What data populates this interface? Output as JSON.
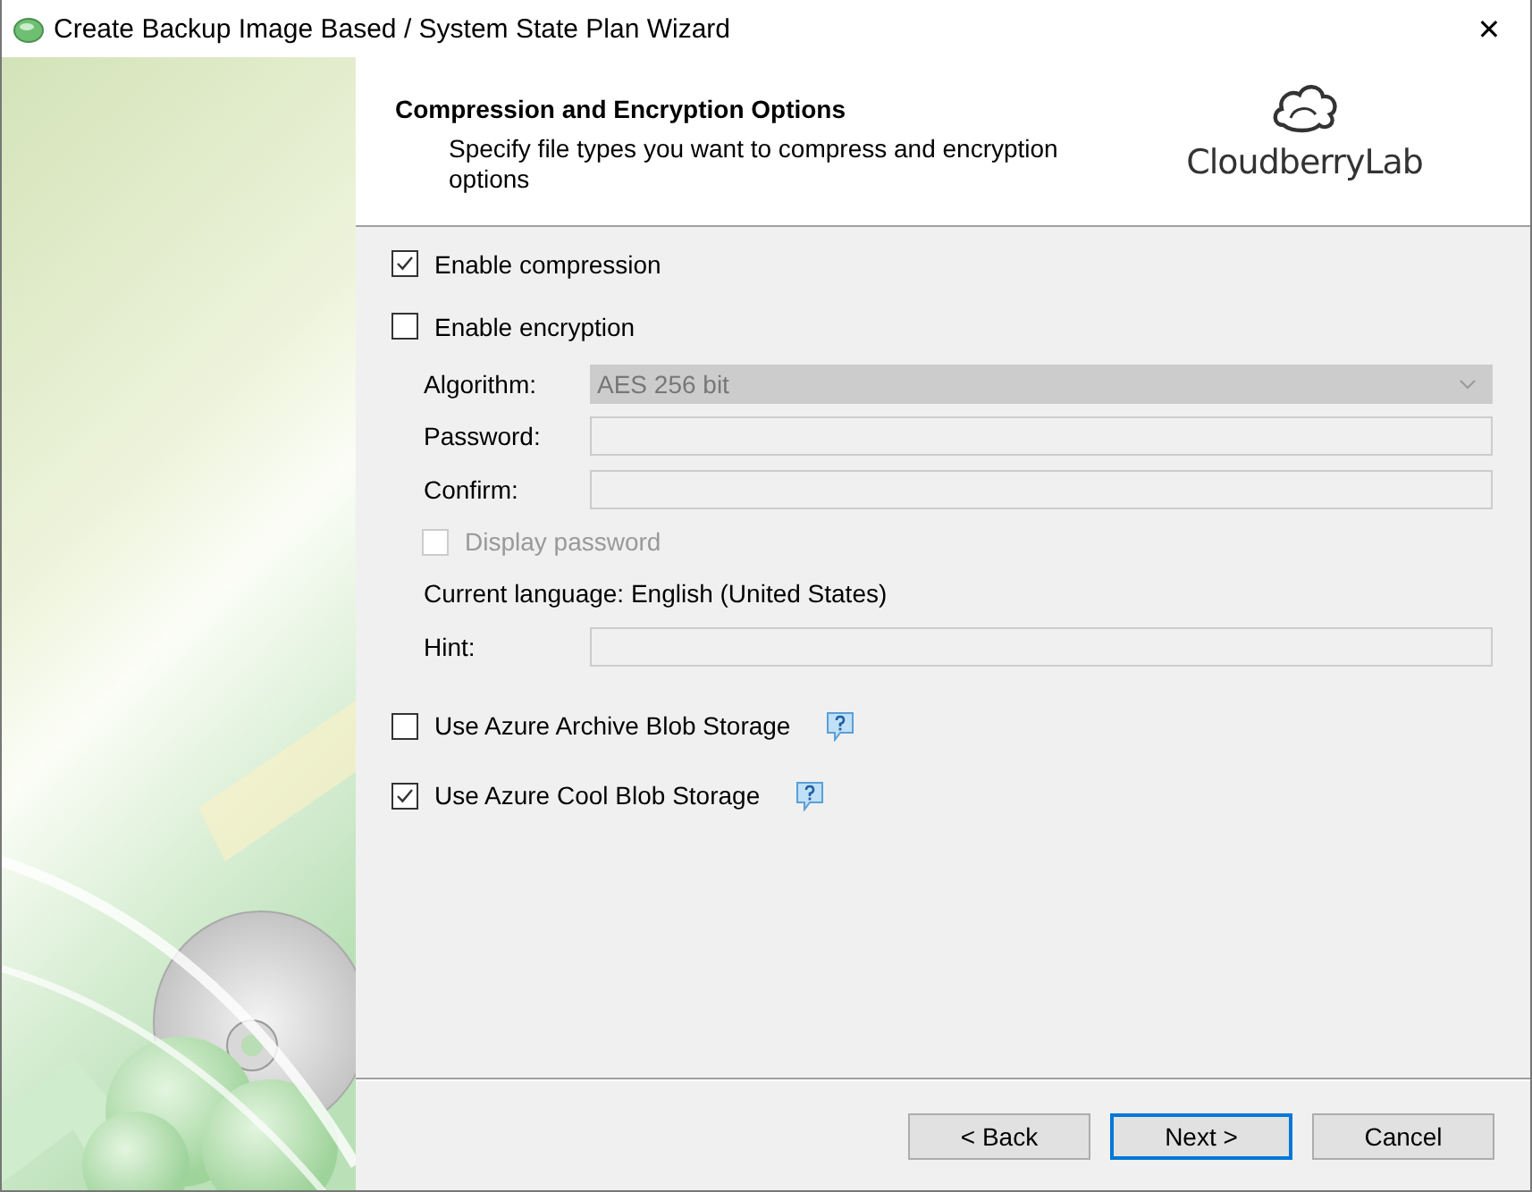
{
  "window": {
    "title": "Create Backup Image Based / System State Plan Wizard",
    "close": "✕"
  },
  "header": {
    "title": "Compression and Encryption Options",
    "subtitle": "Specify file types you want to compress and encryption options",
    "logo_text": "CloudberryLab"
  },
  "items": [
    {
      "kind": "checkbox",
      "label": "Enable compression",
      "checked": true,
      "disabled": false
    },
    {
      "kind": "checkbox",
      "label": "Enable encryption",
      "checked": false,
      "disabled": false
    },
    {
      "kind": "select",
      "label": "Algorithm:",
      "value": "AES 256 bit",
      "disabled": true
    },
    {
      "kind": "input",
      "label": "Password:",
      "disabled": true
    },
    {
      "kind": "input",
      "label": "Confirm:",
      "disabled": true
    },
    {
      "kind": "subcheckbox",
      "label": "Display password",
      "checked": false,
      "disabled": true
    },
    {
      "kind": "note",
      "label": "Current language: English (United States)"
    },
    {
      "kind": "input",
      "label": "Hint:",
      "disabled": true
    },
    {
      "kind": "help-checkbox",
      "label": "Use Azure Archive Blob Storage",
      "checked": false,
      "disabled": false
    },
    {
      "kind": "help-checkbox",
      "label": "Use Azure Cool Blob Storage",
      "checked": true,
      "disabled": false
    }
  ],
  "buttons": [
    {
      "label": "< Back",
      "default": false
    },
    {
      "label": "Next >",
      "default": true
    },
    {
      "label": "Cancel",
      "default": false
    }
  ]
}
